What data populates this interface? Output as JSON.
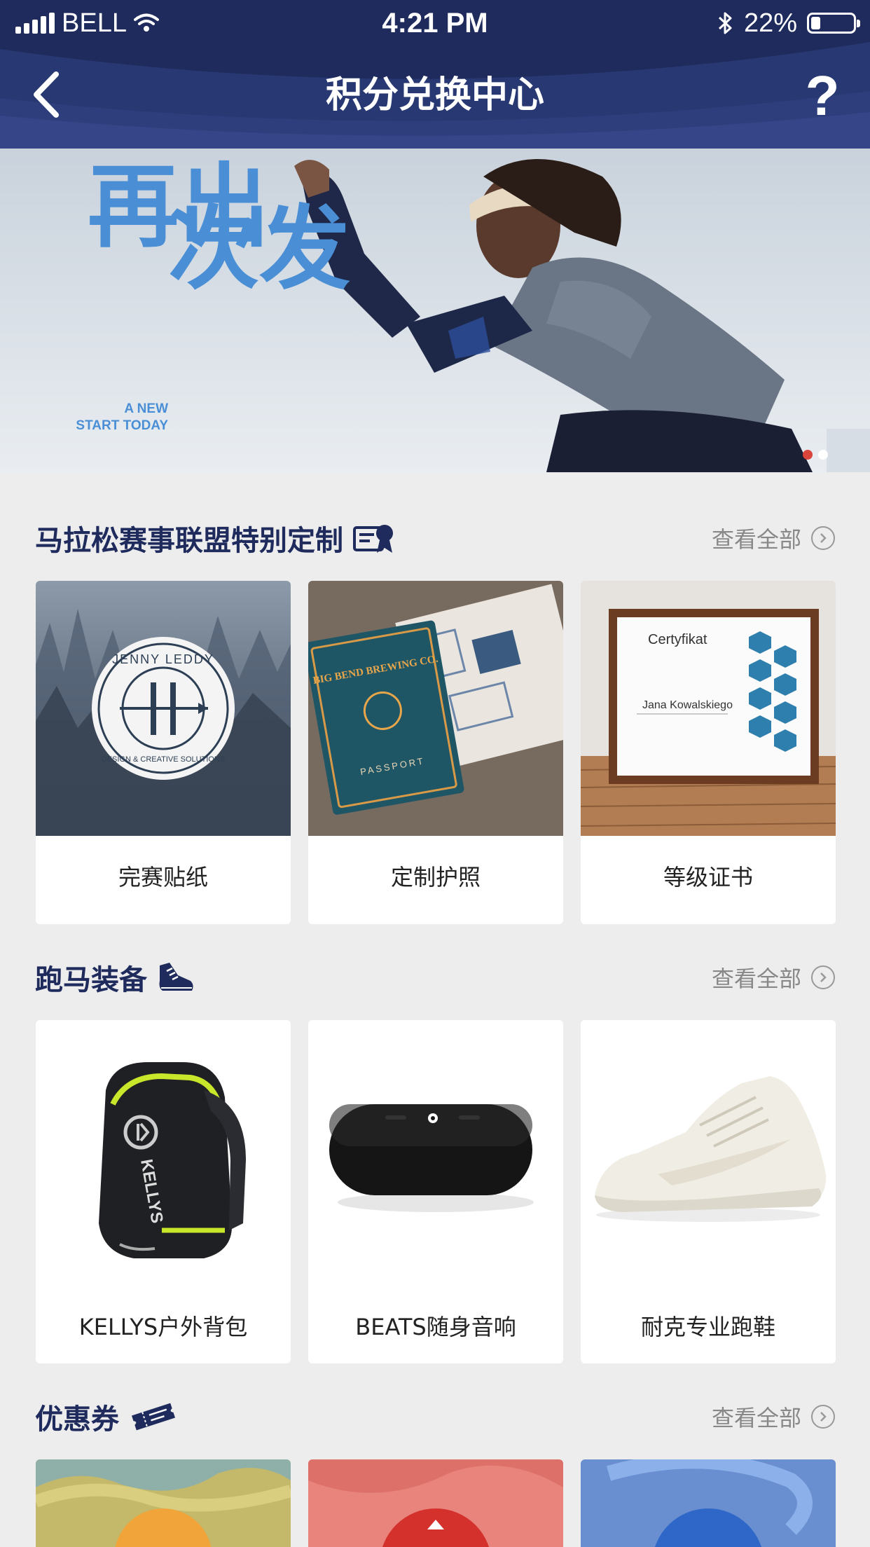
{
  "status_bar": {
    "carrier": "BELL",
    "time": "4:21 PM",
    "battery": "22%",
    "battery_level": 0.22
  },
  "header": {
    "title": "积分兑换中心",
    "help": "?",
    "back_icon": "chevron-left-icon"
  },
  "banner": {
    "headline_col1": "再出",
    "headline_col2": "次发",
    "tagline_line1": "A NEW",
    "tagline_line2": "START TODAY",
    "page_count": 2,
    "active_page": 1
  },
  "sections": [
    {
      "title": "马拉松赛事联盟特别定制",
      "icon": "certificate-badge-icon",
      "view_all": "查看全部",
      "items": [
        {
          "label": "完赛贴纸",
          "badge_top": "JENNY LEDDY",
          "badge_bottom": "DESIGN & CREATIVE SOLUTIONS"
        },
        {
          "label": "定制护照",
          "cover_title": "BIG BEND BREWING CO.",
          "cover_sub": "PASSPORT"
        },
        {
          "label": "等级证书",
          "cert_title": "Certyfikat",
          "cert_name": "Jana Kowalskiego"
        }
      ]
    },
    {
      "title": "跑马装备",
      "icon": "running-shoe-icon",
      "view_all": "查看全部",
      "items": [
        {
          "label": "KELLYS户外背包",
          "brand": "KELLYS"
        },
        {
          "label": "BEATS随身音响"
        },
        {
          "label": "耐克专业跑鞋"
        }
      ]
    },
    {
      "title": "优惠券",
      "icon": "ticket-icon",
      "view_all": "查看全部",
      "items": [
        {},
        {},
        {}
      ]
    }
  ],
  "colors": {
    "header_bg": "#1e2b5c",
    "accent_blue": "#4a8fd6",
    "dot_active": "#d9443b",
    "dot_inactive": "#ffffff"
  }
}
